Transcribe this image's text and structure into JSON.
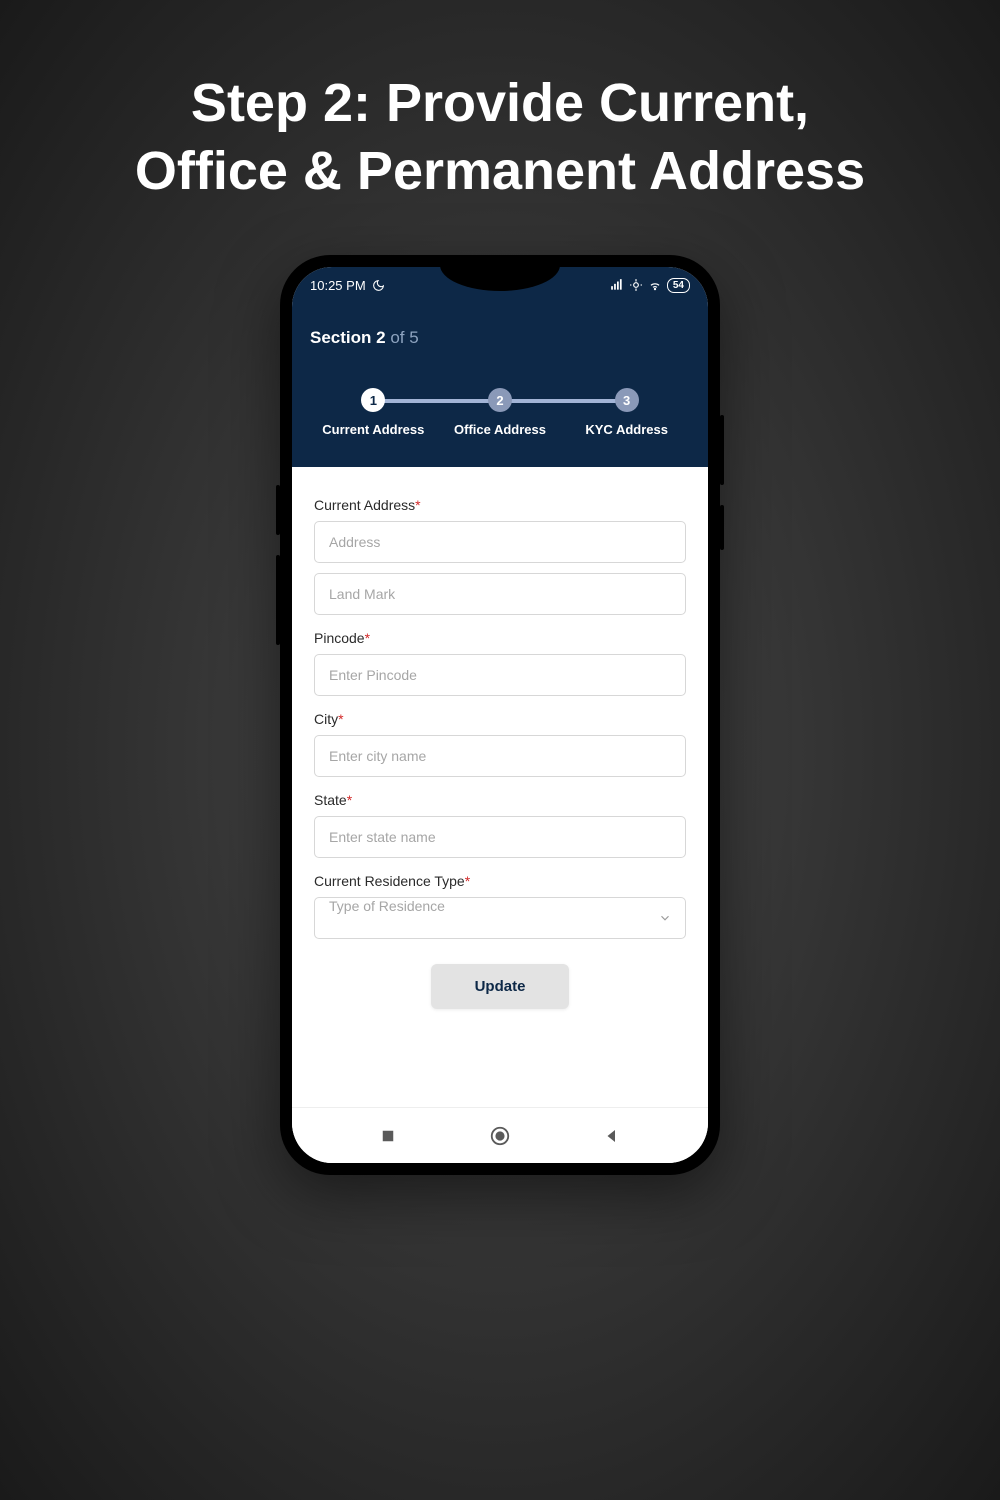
{
  "pageTitleLine1": "Step 2: Provide Current,",
  "pageTitleLine2": "Office & Permanent Address",
  "statusBar": {
    "time": "10:25 PM",
    "battery": "54"
  },
  "header": {
    "sectionPrefix": "Section 2",
    "sectionSuffix": " of 5"
  },
  "stepper": {
    "steps": [
      {
        "num": "1",
        "label": "Current Address",
        "active": true
      },
      {
        "num": "2",
        "label": "Office Address",
        "active": false
      },
      {
        "num": "3",
        "label": "KYC Address",
        "active": false
      }
    ]
  },
  "form": {
    "currentAddress": {
      "label": "Current Address",
      "placeholder": "Address"
    },
    "landmark": {
      "placeholder": "Land Mark"
    },
    "pincode": {
      "label": "Pincode",
      "placeholder": "Enter Pincode"
    },
    "city": {
      "label": "City",
      "placeholder": "Enter city name"
    },
    "state": {
      "label": "State",
      "placeholder": "Enter state name"
    },
    "residenceType": {
      "label": "Current Residence Type",
      "placeholder": "Type of Residence"
    },
    "updateLabel": "Update"
  }
}
